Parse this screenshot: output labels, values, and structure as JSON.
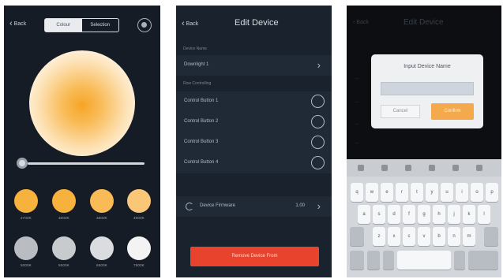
{
  "panel1": {
    "back_label": "Back",
    "segments": [
      "Colour",
      "Selection"
    ],
    "settings_icon": "gear-icon",
    "brightness": 0,
    "swatches": [
      {
        "label": "2700K",
        "color": "#f7b23e"
      },
      {
        "label": "3000K",
        "color": "#f7b23e"
      },
      {
        "label": "3500K",
        "color": "#f8bb55"
      },
      {
        "label": "4000K",
        "color": "#f9c777"
      },
      {
        "label": "5000K",
        "color": "#b9bcc0"
      },
      {
        "label": "5500K",
        "color": "#c8cbce"
      },
      {
        "label": "6500K",
        "color": "#dadcdf"
      },
      {
        "label": "7500K",
        "color": "#f3f3f3"
      }
    ]
  },
  "panel2": {
    "back_label": "Back",
    "title": "Edit Device",
    "device_name_heading": "Device Name",
    "device_name": "Downlight 1",
    "controls_heading": "Row Controlling",
    "control_buttons": [
      "Control Button 1",
      "Control Button 2",
      "Control Button 3",
      "Control Button 4"
    ],
    "firmware_label": "Device Firmware",
    "firmware_version": "1.00",
    "remove_label": "Remove Device From"
  },
  "panel3": {
    "back_label": "Back",
    "title": "Edit Device",
    "dialog_title": "Input Device Name",
    "cancel_label": "Cancel",
    "confirm_label": "Confirm",
    "keyboard_rows": [
      [
        "q",
        "w",
        "e",
        "r",
        "t",
        "y",
        "u",
        "i",
        "o",
        "p"
      ],
      [
        "a",
        "s",
        "d",
        "f",
        "g",
        "h",
        "j",
        "k",
        "l"
      ],
      [
        "z",
        "x",
        "c",
        "v",
        "b",
        "n",
        "m"
      ]
    ]
  }
}
